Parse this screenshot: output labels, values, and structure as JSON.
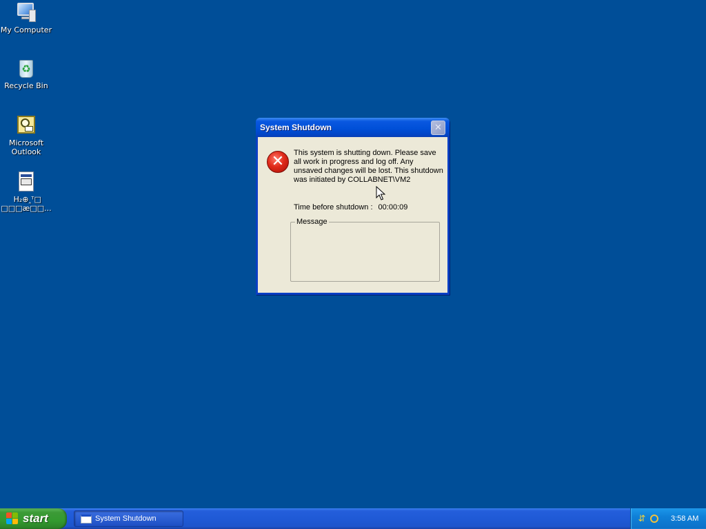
{
  "desktop": {
    "icons": [
      {
        "label": "My Computer"
      },
      {
        "label": "Recycle Bin"
      },
      {
        "label_line1": "Microsoft",
        "label_line2": "Outlook"
      },
      {
        "label_line1": " H₂⊕‸ᵀ□",
        "label_line2": "□□□æ□□..."
      }
    ]
  },
  "dialog": {
    "title": "System Shutdown",
    "close_glyph": "✕",
    "message": "This system is shutting down. Please save all work in progress and log off. Any unsaved changes will be lost. This shutdown was initiated by COLLABNET\\VM2",
    "timer_label": "Time before shutdown :",
    "timer_value": "00:00:09",
    "message_group_label": "Message",
    "error_icon": "error-x-icon"
  },
  "taskbar": {
    "start_label": "start",
    "tasks": [
      {
        "label": "System Shutdown"
      }
    ],
    "tray": {
      "icons": [
        "network-icon",
        "search-icon"
      ],
      "clock": "3:58 AM"
    }
  },
  "colors": {
    "desktop_bg": "#004e98",
    "title_bar": "#0050d8",
    "dialog_face": "#ece9d8",
    "start_green": "#339a2f"
  }
}
